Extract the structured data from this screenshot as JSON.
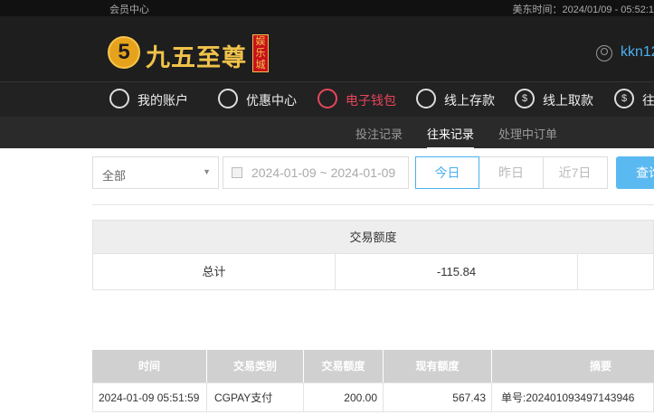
{
  "topbar": {
    "left": "会员中心",
    "right": "美东时间：2024/01/09 - 05:52:1"
  },
  "logo": {
    "mark": "5",
    "name": "九五至尊",
    "badge": "娱乐城"
  },
  "user": {
    "name": "kkn12"
  },
  "nav": [
    {
      "label": "我的账户",
      "icon": "user-icon",
      "glyph": ""
    },
    {
      "label": "优惠中心",
      "icon": "gift-icon",
      "glyph": ""
    },
    {
      "label": "电子钱包",
      "icon": "wallet-icon",
      "glyph": ""
    },
    {
      "label": "线上存款",
      "icon": "deposit-icon",
      "glyph": ""
    },
    {
      "label": "线上取款",
      "icon": "withdraw-icon",
      "glyph": "$"
    },
    {
      "label": "往",
      "icon": "history-icon",
      "glyph": "$"
    }
  ],
  "subnav": [
    "投注记录",
    "往来记录",
    "处理中订单"
  ],
  "subnav_active": "往来记录",
  "filter": {
    "select_value": "全部",
    "date_range": "2024-01-09 ~ 2024-01-09",
    "segments": [
      "今日",
      "昨日",
      "近7日"
    ],
    "active_segment": "今日",
    "query_label": "查询"
  },
  "summary": {
    "header": "交易额度",
    "row_label": "总计",
    "row_value": "-115.84"
  },
  "table": {
    "columns": [
      "时间",
      "交易类别",
      "交易额度",
      "现有额度",
      "摘要"
    ],
    "rows": [
      [
        "2024-01-09 05:51:59",
        "CGPAY支付",
        "200.00",
        "567.43",
        "单号:202401093497143946"
      ]
    ]
  },
  "colors": {
    "accent": "#4ab0f0",
    "active_nav": "#e8455c",
    "logo_gold": "#f0c24a"
  }
}
